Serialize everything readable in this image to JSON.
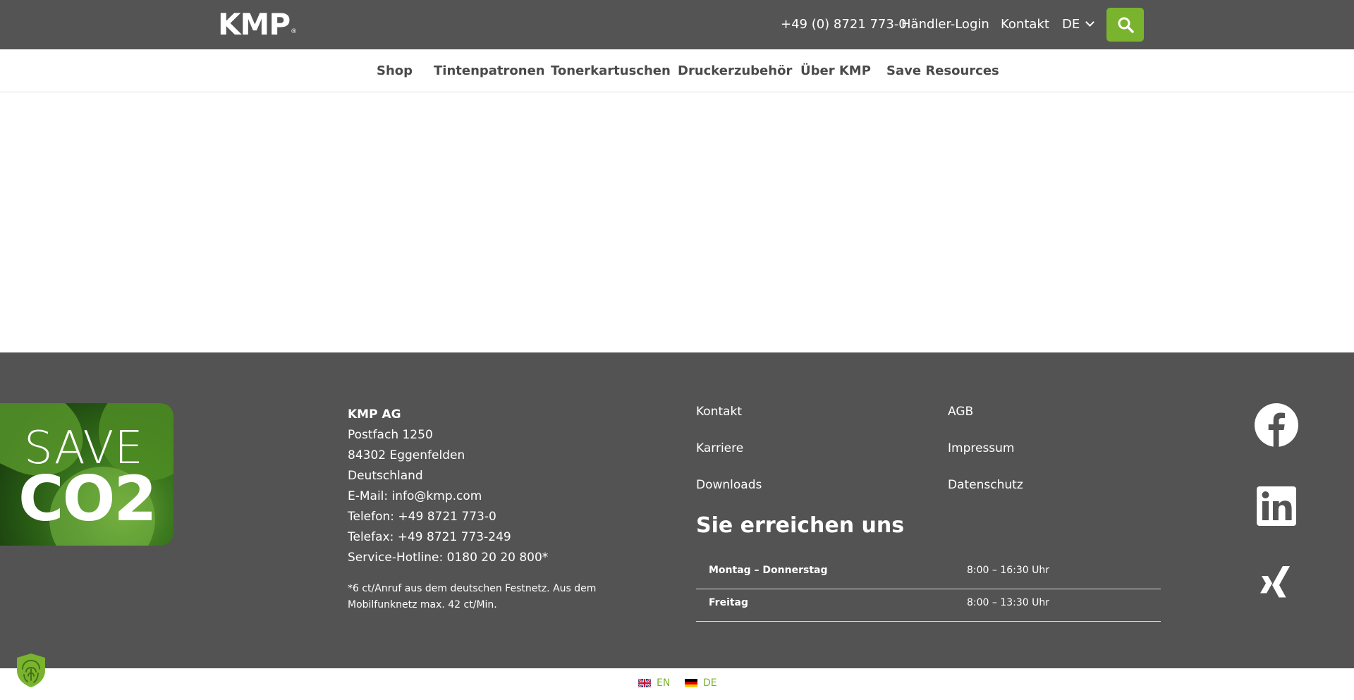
{
  "header": {
    "logo_text": "KMP",
    "logo_reg": "®",
    "phone": "+49 (0) 8721 773-0",
    "login": "Händler-Login",
    "contact": "Kontakt",
    "language": "DE",
    "search_icon": "search-icon",
    "accent_color": "#7ab32e",
    "bar_color": "#545454"
  },
  "nav": {
    "items": [
      {
        "label": "Shop"
      },
      {
        "label": "Tintenpatronen"
      },
      {
        "label": "Tonerkartuschen"
      },
      {
        "label": "Druckerzubehör"
      },
      {
        "label": "Über KMP"
      },
      {
        "label": "Save Resources"
      }
    ]
  },
  "footer": {
    "co2_badge": {
      "line1": "SAVE",
      "line2": "CO2"
    },
    "address": {
      "company": "KMP AG",
      "lines": [
        "Postfach 1250",
        "84302 Eggenfelden",
        "Deutschland",
        "E-Mail: info@kmp.com",
        "Telefon: +49 8721 773-0",
        "Telefax: +49 8721 773-249",
        "Service-Hotline: 0180 20 20 800*"
      ],
      "note": "*6 ct/Anruf aus dem deutschen Festnetz. Aus dem Mobilfunknetz max. 42 ct/Min."
    },
    "links_col1": [
      {
        "label": "Kontakt"
      },
      {
        "label": "Karriere"
      },
      {
        "label": "Downloads"
      }
    ],
    "links_col2": [
      {
        "label": "AGB"
      },
      {
        "label": "Impressum"
      },
      {
        "label": "Datenschutz"
      }
    ],
    "reach_title": "Sie erreichen uns",
    "hours": [
      {
        "day": "Montag – Donnerstag",
        "time": "8:00 – 16:30 Uhr"
      },
      {
        "day": "Freitag",
        "time": "8:00 – 13:30 Uhr"
      }
    ],
    "social": [
      "facebook-icon",
      "linkedin-icon",
      "xing-icon"
    ]
  },
  "languages": [
    {
      "code": "EN"
    },
    {
      "code": "DE"
    }
  ]
}
